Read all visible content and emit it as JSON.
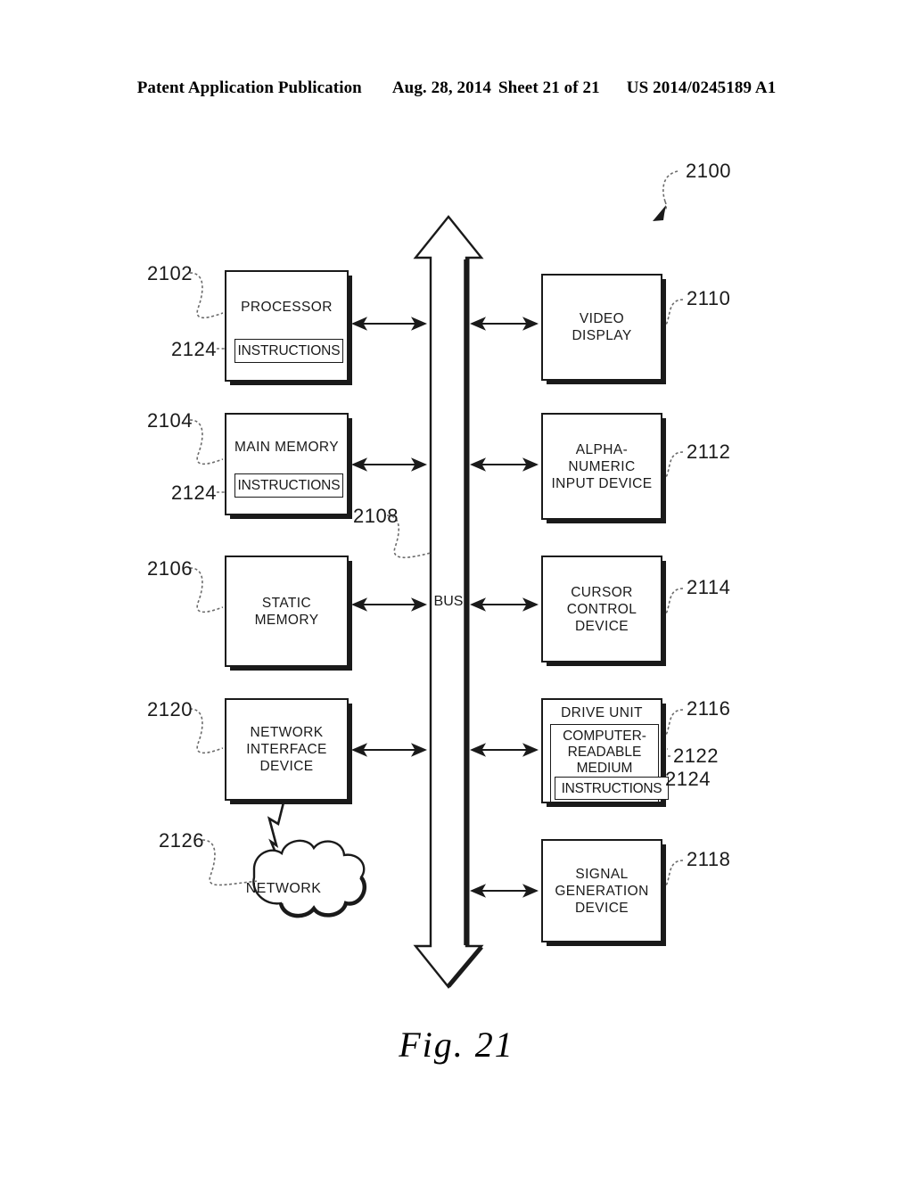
{
  "header": {
    "publication": "Patent Application Publication",
    "date": "Aug. 28, 2014",
    "sheet": "Sheet 21 of 21",
    "patent_number": "US 2014/0245189 A1"
  },
  "figure": {
    "caption": "Fig. 21",
    "system_ref": "2100"
  },
  "blocks": {
    "processor": {
      "label": "PROCESSOR",
      "ref": "2102"
    },
    "processor_instructions": {
      "label": "INSTRUCTIONS",
      "ref": "2124"
    },
    "main_memory": {
      "label": "MAIN MEMORY",
      "ref": "2104"
    },
    "main_memory_instructions": {
      "label": "INSTRUCTIONS",
      "ref": "2124"
    },
    "static_memory": {
      "label": "STATIC\nMEMORY",
      "ref": "2106"
    },
    "network_interface_device": {
      "label": "NETWORK\nINTERFACE\nDEVICE",
      "ref": "2120"
    },
    "network_cloud": {
      "label": "NETWORK",
      "ref": "2126"
    },
    "video_display": {
      "label": "VIDEO\nDISPLAY",
      "ref": "2110"
    },
    "alpha_numeric_input_device": {
      "label": "ALPHA-NUMERIC\nINPUT DEVICE",
      "ref": "2112"
    },
    "cursor_control_device": {
      "label": "CURSOR\nCONTROL\nDEVICE",
      "ref": "2114"
    },
    "drive_unit": {
      "label": "DRIVE UNIT",
      "ref": "2116"
    },
    "computer_readable_medium": {
      "label": "COMPUTER-\nREADABLE\nMEDIUM",
      "ref": "2122"
    },
    "drive_instructions": {
      "label": "INSTRUCTIONS",
      "ref": "2124"
    },
    "signal_generation_device": {
      "label": "SIGNAL\nGENERATION\nDEVICE",
      "ref": "2118"
    },
    "bus": {
      "label": "BUS",
      "ref": "2108"
    }
  },
  "colors": {
    "ink": "#1a1a1a",
    "paper": "#ffffff"
  }
}
